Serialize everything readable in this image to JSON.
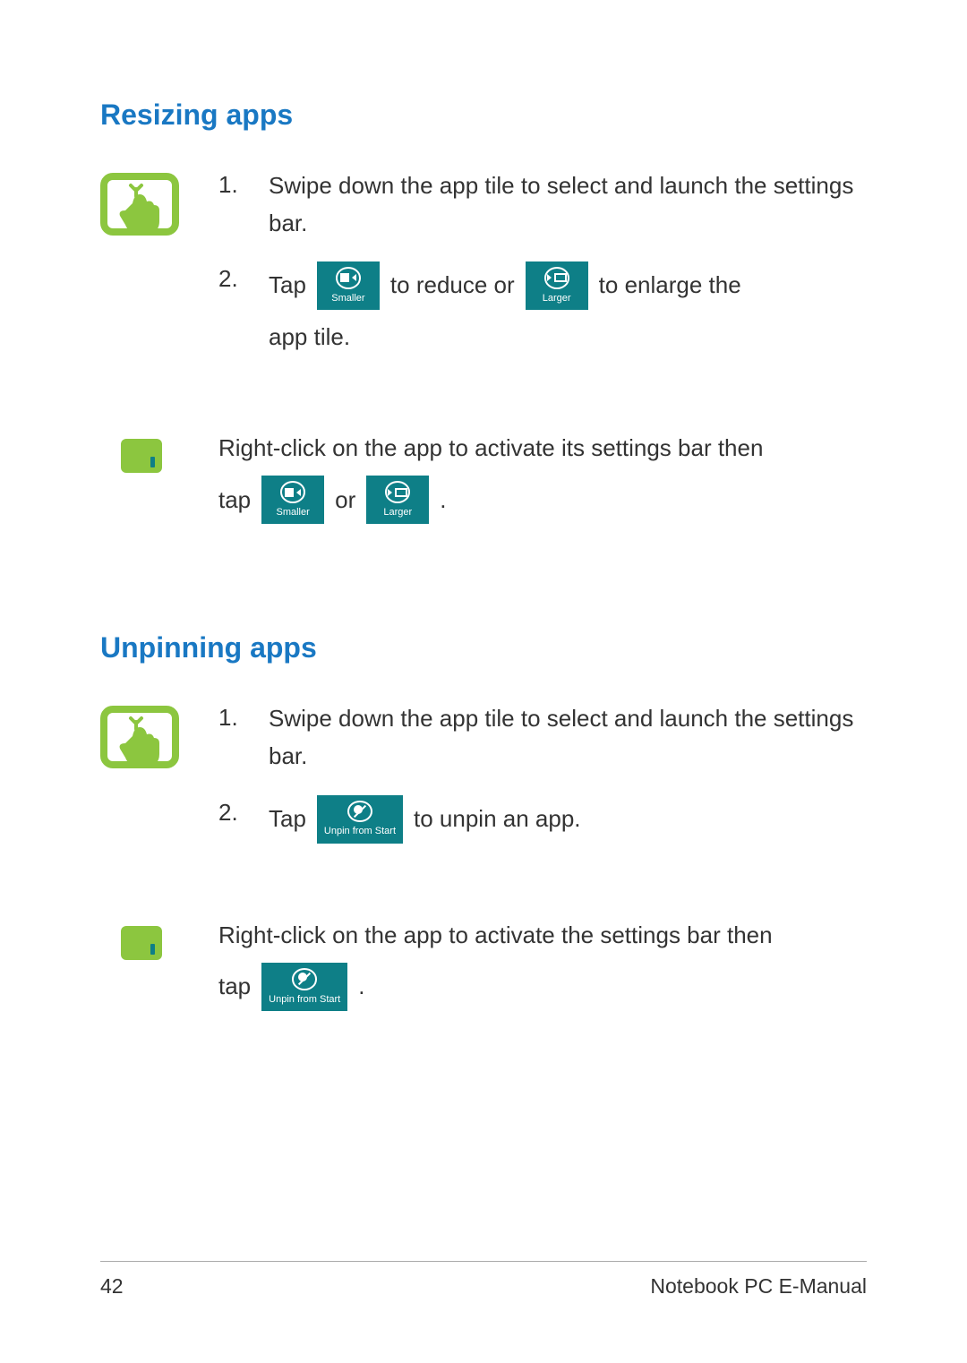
{
  "headings": {
    "resizing": "Resizing apps",
    "unpinning": "Unpinning apps"
  },
  "resizing": {
    "touch": {
      "step1_num": "1.",
      "step1_text": "Swipe down the app tile to select and launch the settings bar.",
      "step2_num": "2.",
      "step2_a": "Tap",
      "step2_b": "to reduce or",
      "step2_c": "to enlarge the",
      "step2_d": "app tile."
    },
    "touchpad": {
      "line1": "Right-click on the app to activate its settings bar then",
      "tap": "tap",
      "or": "or",
      "period": "."
    }
  },
  "unpinning": {
    "touch": {
      "step1_num": "1.",
      "step1_text": "Swipe down the app tile to select and launch the settings bar.",
      "step2_num": "2.",
      "step2_a": "Tap",
      "step2_b": "to unpin an app."
    },
    "touchpad": {
      "line1": "Right-click on the app to activate the settings bar then",
      "tap": "tap",
      "period": "."
    }
  },
  "buttons": {
    "smaller": "Smaller",
    "larger": "Larger",
    "unpin": "Unpin from Start"
  },
  "footer": {
    "page": "42",
    "doc": "Notebook PC E-Manual"
  }
}
